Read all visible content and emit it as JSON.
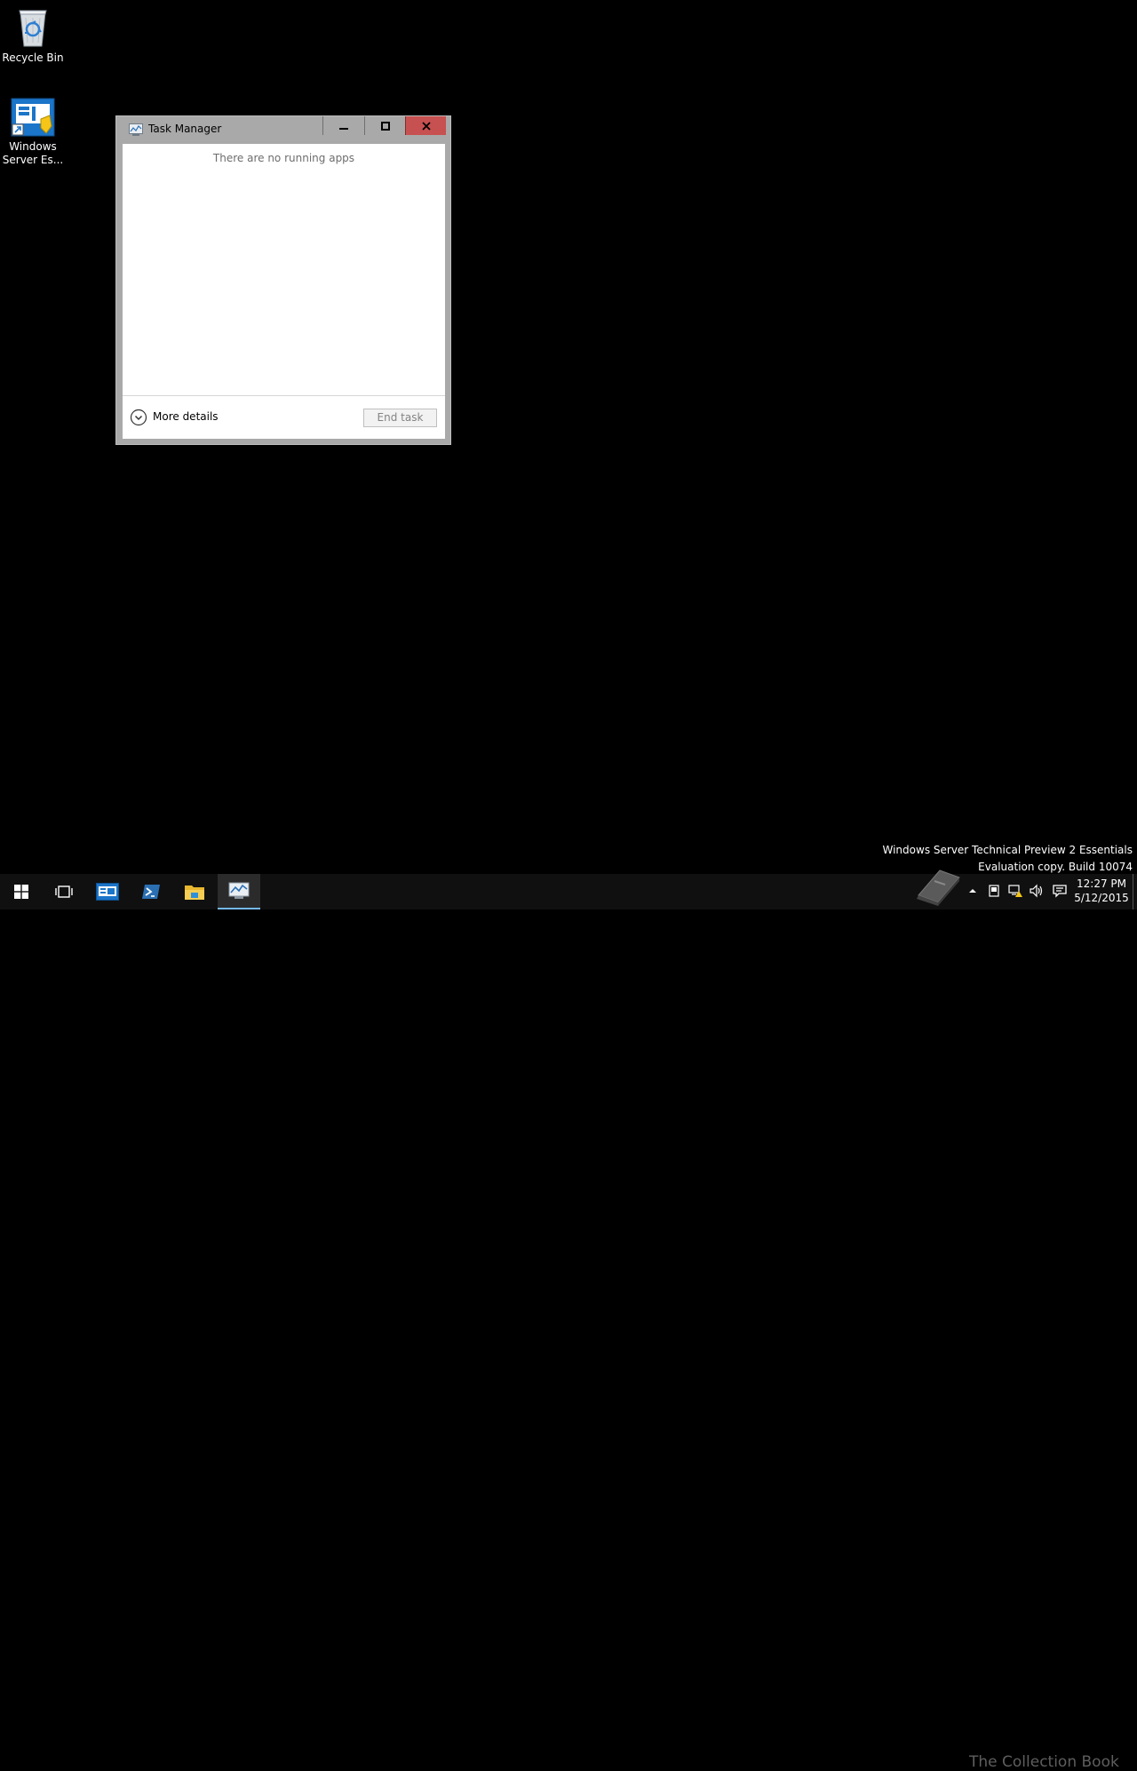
{
  "desktop": {
    "icons": [
      {
        "label": "Recycle Bin",
        "icon": "recycle-bin-icon"
      },
      {
        "label": "Windows Server Es...",
        "icon": "windows-server-essentials-icon"
      }
    ]
  },
  "task_manager": {
    "title": "Task Manager",
    "empty_message": "There are no running apps",
    "more_details_label": "More details",
    "end_task_label": "End task",
    "close_button_color": "#c75050"
  },
  "watermark": {
    "line1": "Windows Server Technical Preview 2 Essentials",
    "line2": "Evaluation copy. Build 10074"
  },
  "overlay_logo": {
    "text": "The Collection Book"
  },
  "taskbar": {
    "items": [
      {
        "name": "start",
        "icon": "windows-logo-icon"
      },
      {
        "name": "task-view",
        "icon": "task-view-icon"
      },
      {
        "name": "server-essentials-dashboard",
        "icon": "dashboard-icon"
      },
      {
        "name": "powershell",
        "icon": "powershell-icon"
      },
      {
        "name": "file-explorer",
        "icon": "folder-icon"
      },
      {
        "name": "task-manager",
        "icon": "task-manager-icon",
        "active": true
      }
    ],
    "clock": {
      "time": "12:27 PM",
      "date": "5/12/2015"
    },
    "accent_color": "#76b9ed"
  }
}
